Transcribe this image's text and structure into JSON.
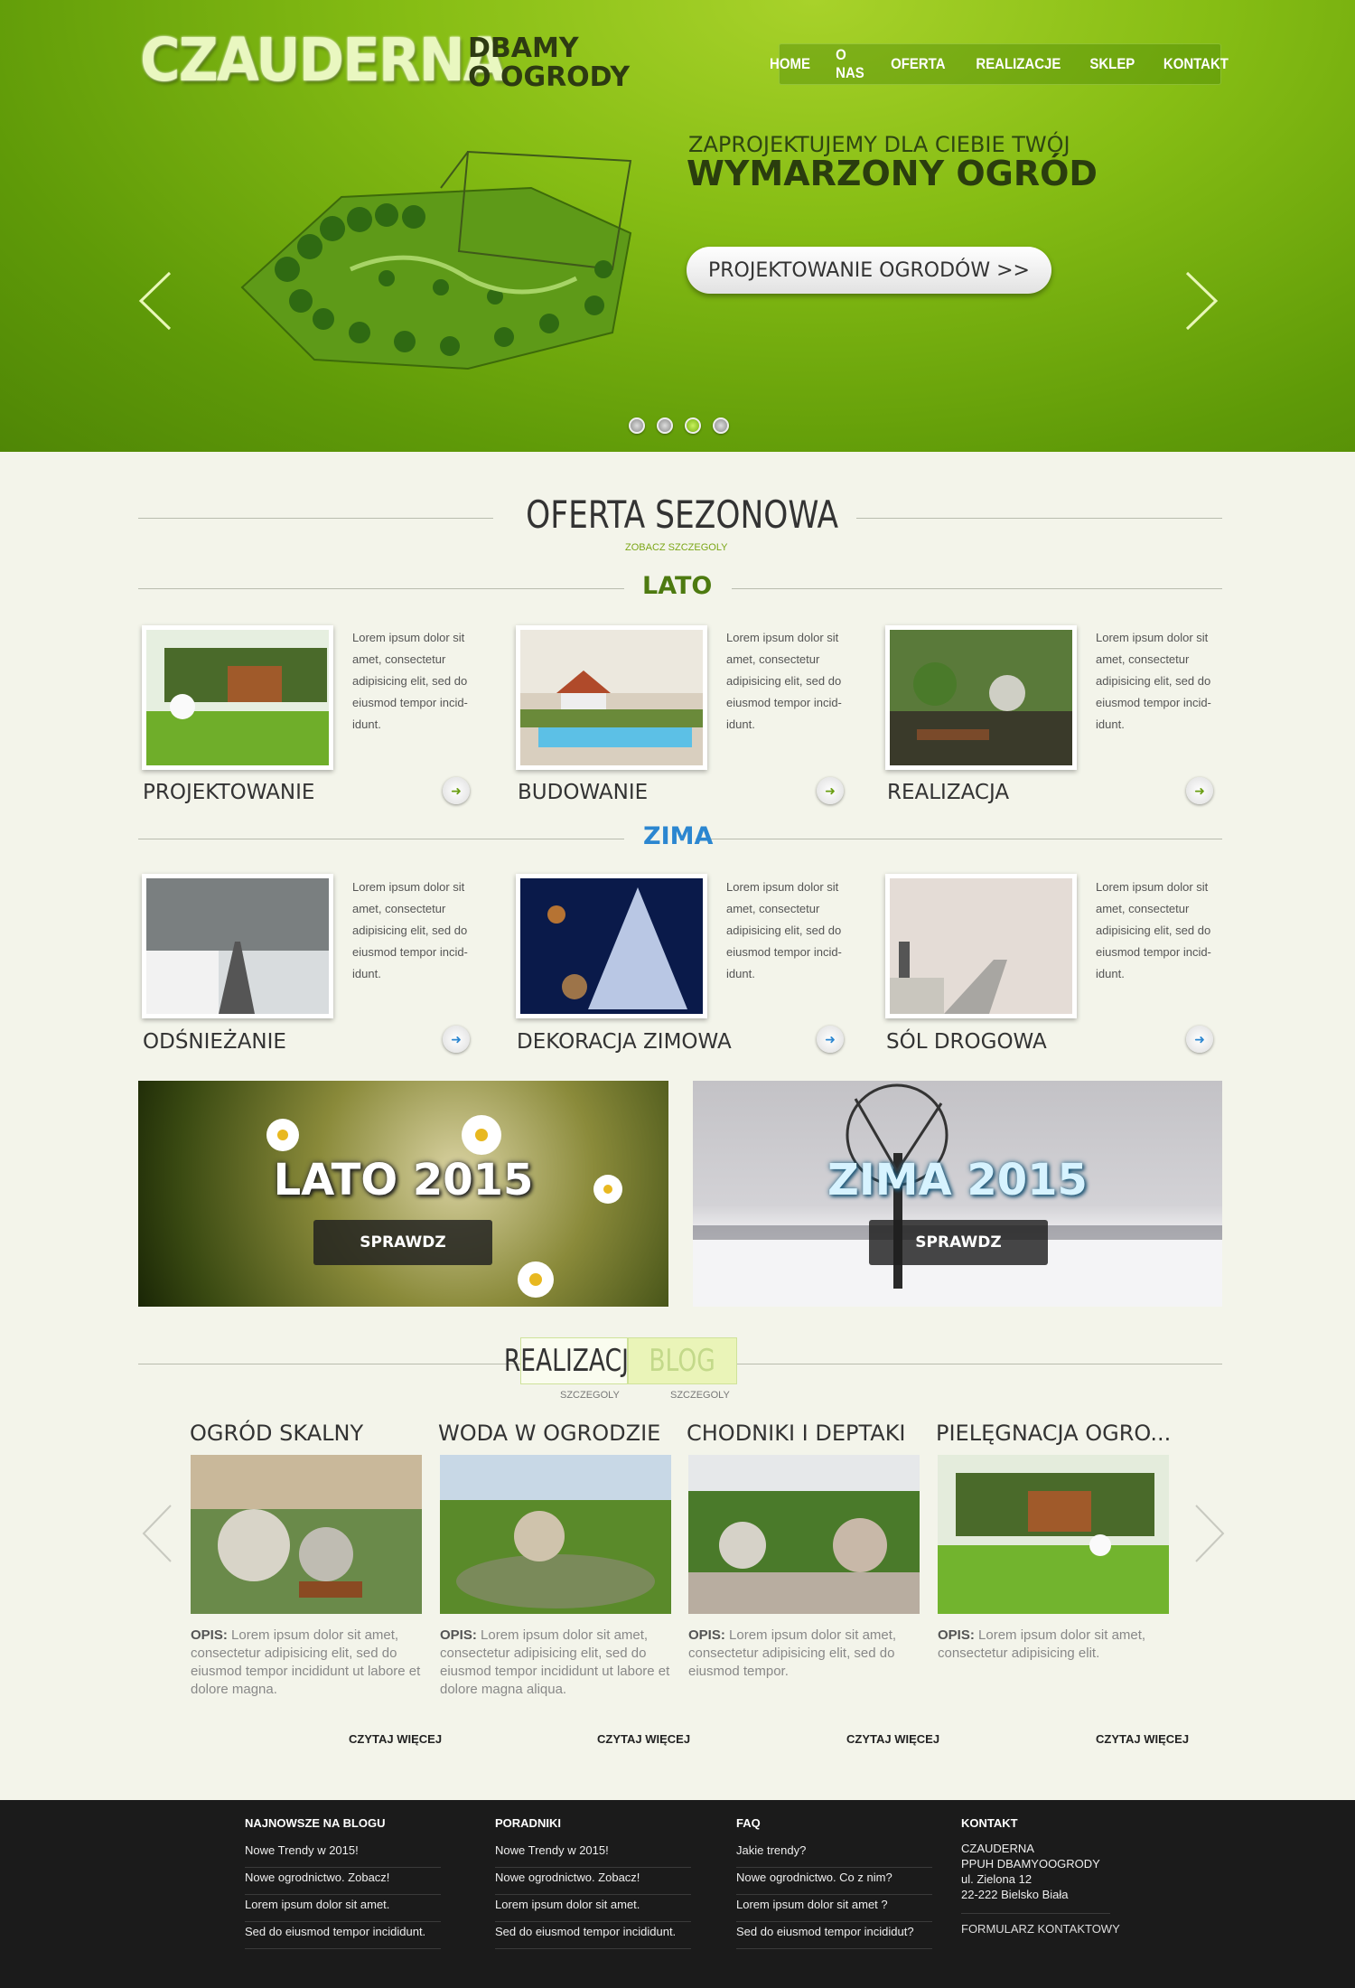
{
  "brand": {
    "name": "CZAUDERNA",
    "tagline_line1": "DBAMY",
    "tagline_line2": "O OGRODY"
  },
  "nav": {
    "items": [
      "HOME",
      "O NAS",
      "OFERTA",
      "REALIZACJE",
      "SKLEP",
      "KONTAKT"
    ]
  },
  "hero": {
    "subtitle": "ZAPROJEKTUJEMY DLA CIEBIE TWÓJ",
    "title": "WYMARZONY OGRÓD",
    "cta_label": "PROJEKTOWANIE OGRODÓW >>",
    "slide_count": 4,
    "active_slide": 3
  },
  "offer": {
    "title": "OFERTA SEZONOWA",
    "subtitle": "ZOBACZ SZCZEGOLY",
    "summer": {
      "label": "LATO",
      "color": "#4d7a10",
      "items": [
        {
          "title": "PROJEKTOWANIE",
          "text": "Lorem ipsum dolor sit amet, consectetur adipisicing elit, sed do eiusmod tempor incid-idunt."
        },
        {
          "title": "BUDOWANIE",
          "text": "Lorem ipsum dolor sit amet, consectetur adipisicing elit, sed do eiusmod tempor incid-idunt."
        },
        {
          "title": "REALIZACJA",
          "text": "Lorem ipsum dolor sit amet, consectetur adipisicing elit, sed do eiusmod tempor incid-idunt."
        }
      ]
    },
    "winter": {
      "label": "ZIMA",
      "color": "#2b86d0",
      "items": [
        {
          "title": "ODŚNIEŻANIE",
          "text": "Lorem ipsum dolor sit amet, consectetur adipisicing elit, sed do eiusmod tempor incid-idunt."
        },
        {
          "title": "DEKORACJA ZIMOWA",
          "text": "Lorem ipsum dolor sit amet, consectetur adipisicing elit, sed do eiusmod tempor incid-idunt."
        },
        {
          "title": "SÓL DROGOWA",
          "text": "Lorem ipsum dolor sit amet, consectetur adipisicing elit, sed do eiusmod tempor incid-idunt."
        }
      ]
    }
  },
  "promos": [
    {
      "title": "LATO 2015",
      "button": "SPRAWDZ"
    },
    {
      "title": "ZIMA 2015",
      "button": "SPRAWDZ"
    }
  ],
  "projects": {
    "tab_active": "REALIZACJE",
    "tab_inactive": "BLOG",
    "tab_active_sub": "SZCZEGOLY",
    "tab_inactive_sub": "SZCZEGOLY",
    "desc_label": "OPIS:",
    "more_label": "CZYTAJ WIĘCEJ",
    "items": [
      {
        "title": "OGRÓD SKALNY",
        "desc": "Lorem ipsum dolor sit amet, consectetur adipisicing elit, sed do eiusmod tempor incididunt ut labore et dolore magna."
      },
      {
        "title": "WODA W OGRODZIE",
        "desc": "Lorem ipsum dolor sit amet, consectetur adipisicing elit, sed do eiusmod tempor incididunt ut labore et dolore magna aliqua."
      },
      {
        "title": "CHODNIKI I DEPTAKI",
        "desc": "Lorem ipsum dolor sit amet, consectetur adipisicing elit, sed do eiusmod tempor."
      },
      {
        "title": "PIELĘGNACJA OGRO...",
        "desc": "Lorem ipsum dolor sit amet, consectetur adipisicing elit."
      }
    ]
  },
  "footer": {
    "blog": {
      "heading": "NAJNOWSZE NA BLOGU",
      "links": [
        "Nowe Trendy w 2015!",
        "Nowe ogrodnictwo. Zobacz!",
        "Lorem ipsum dolor sit amet.",
        "Sed do eiusmod tempor incididunt."
      ]
    },
    "guides": {
      "heading": "PORADNIKI",
      "links": [
        "Nowe Trendy w 2015!",
        "Nowe ogrodnictwo. Zobacz!",
        "Lorem ipsum dolor sit amet.",
        "Sed do eiusmod tempor incididunt."
      ]
    },
    "faq": {
      "heading": "FAQ",
      "links": [
        "Jakie trendy?",
        "Nowe ogrodnictwo. Co z nim?",
        "Lorem ipsum dolor sit amet ?",
        "Sed do eiusmod tempor incididut?"
      ]
    },
    "contact": {
      "heading": "KONTAKT",
      "lines": [
        "CZAUDERNA",
        "PPUH DBAMYOOGRODY",
        "ul. Zielona 12",
        "22-222 Bielsko Biała"
      ],
      "form_link": "FORMULARZ KONTAKTOWY"
    }
  },
  "colors": {
    "brand_green": "#86bd14",
    "footer_bg": "#1b1b1b",
    "summer_arrow": "#6a9e12",
    "winter_arrow": "#2b86d0"
  }
}
